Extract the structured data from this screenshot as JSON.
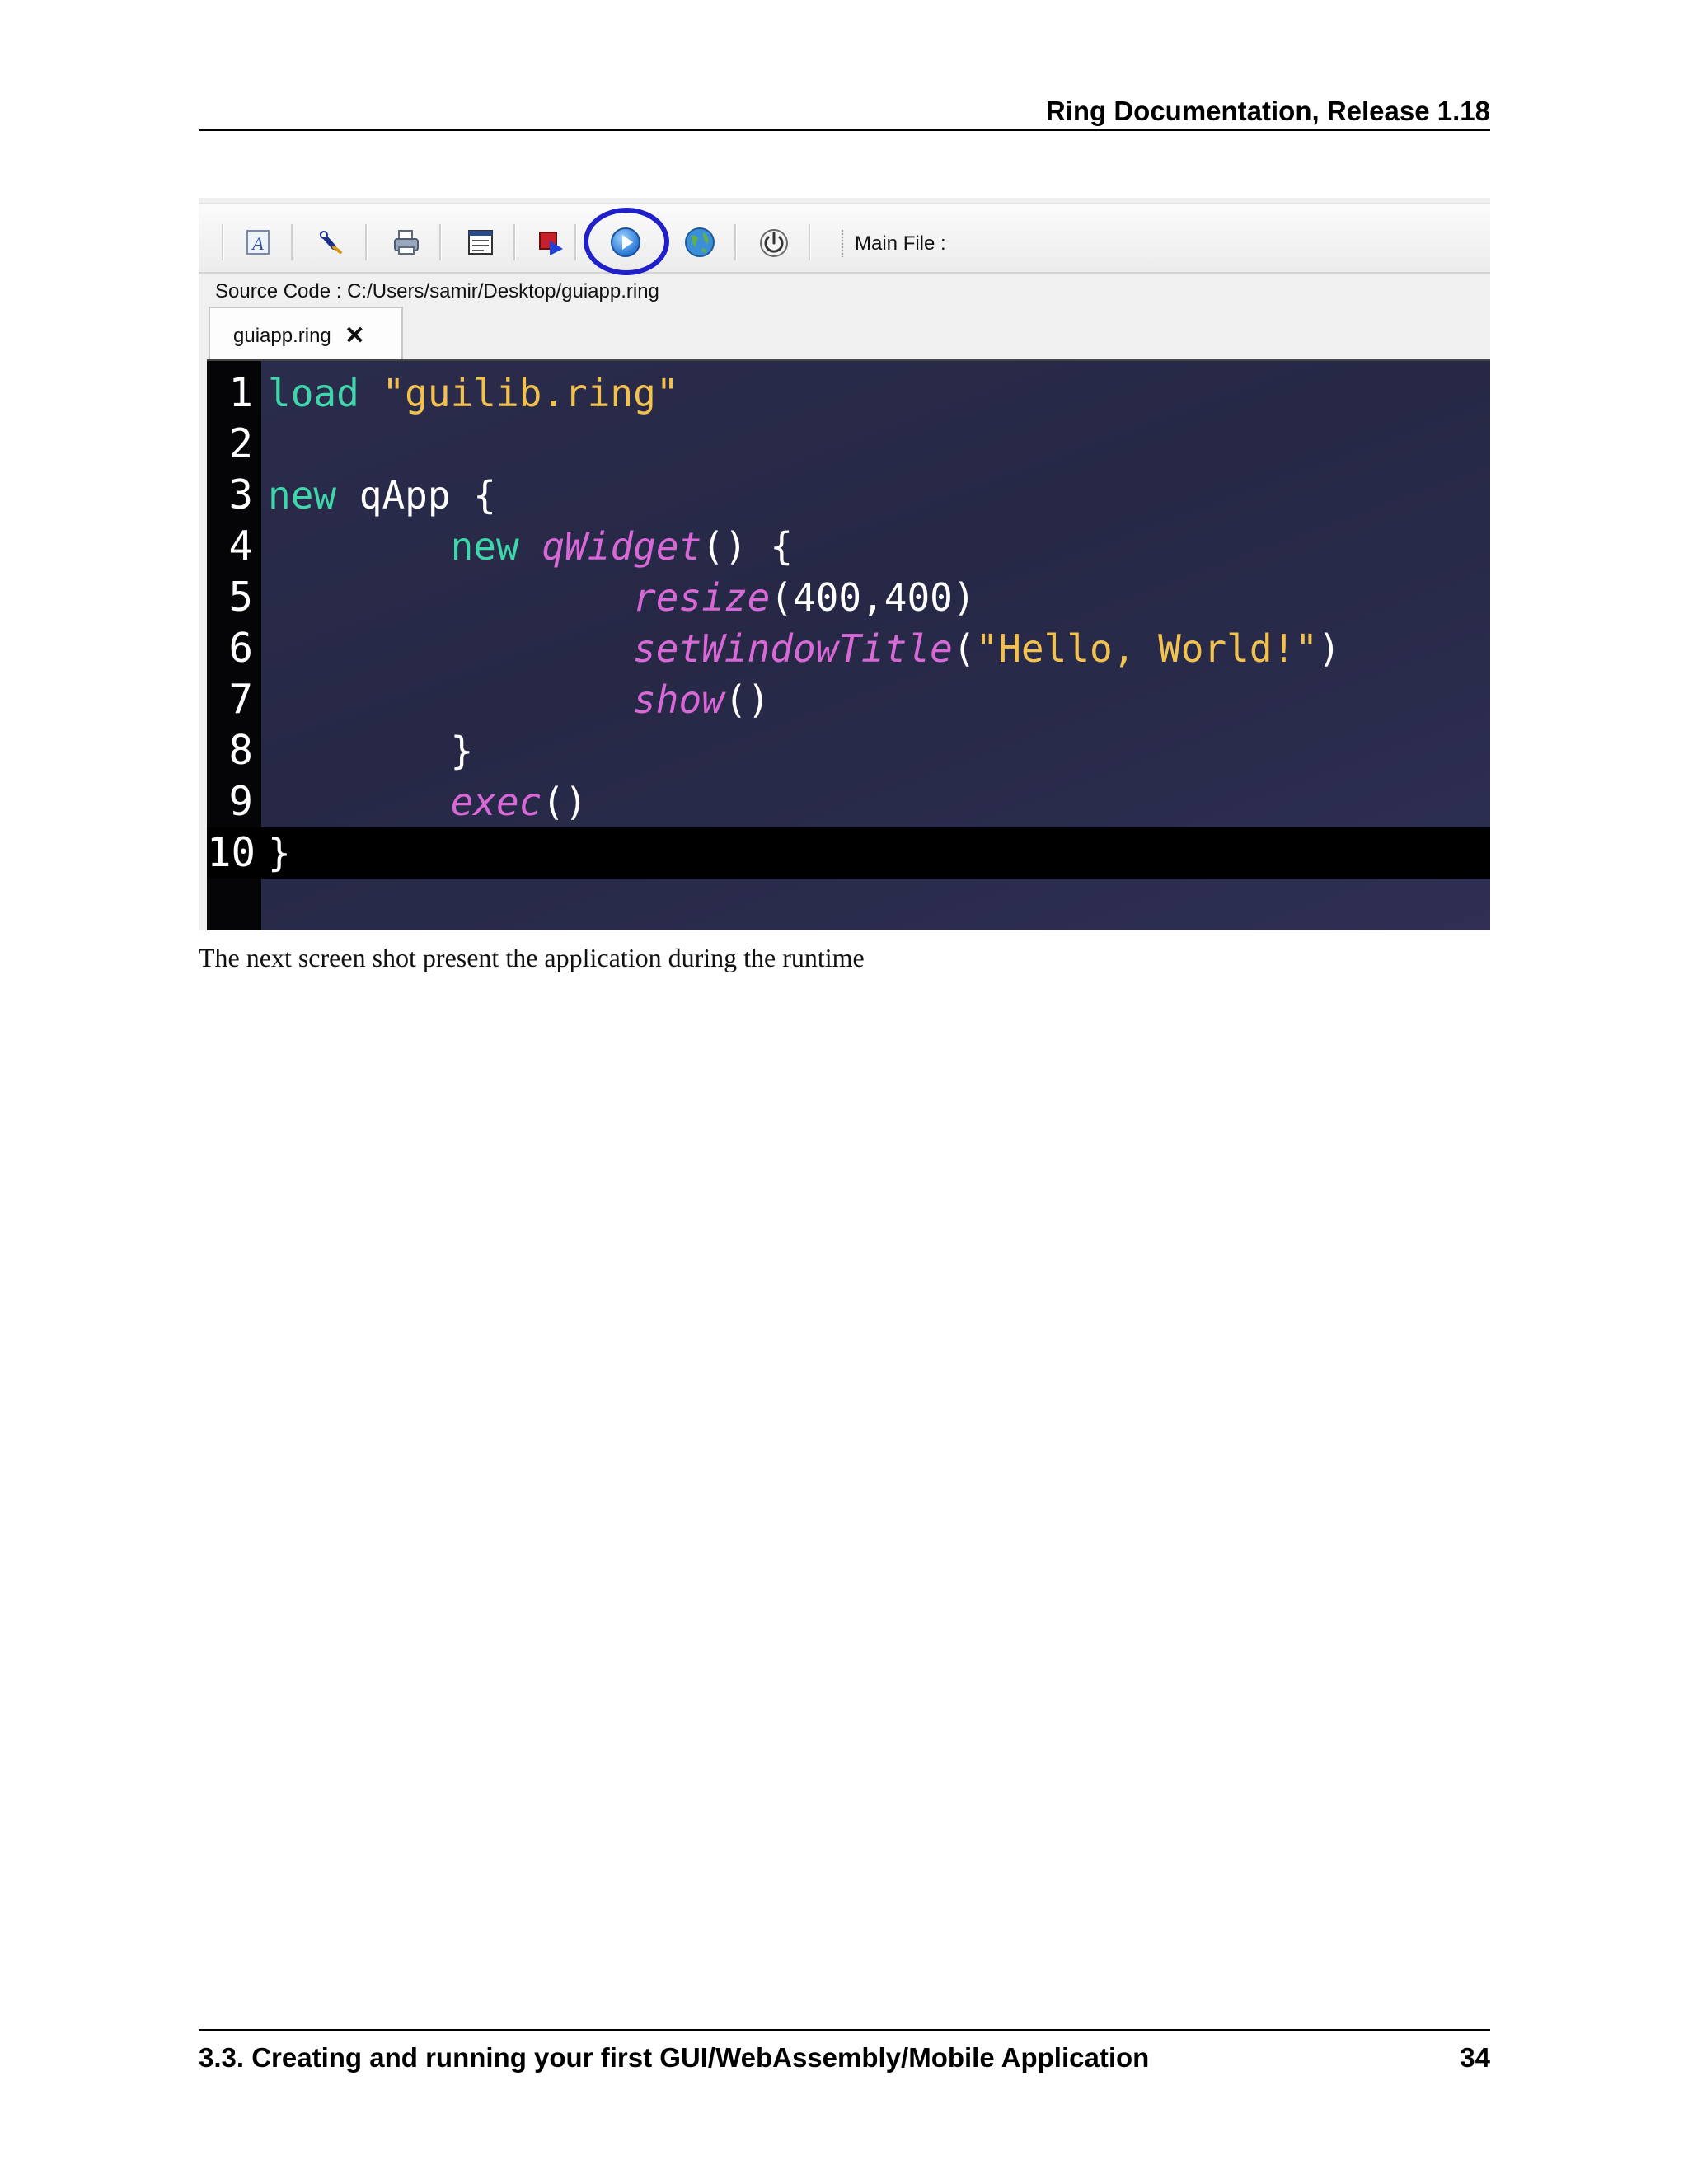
{
  "header": {
    "title": "Ring Documentation, Release 1.18"
  },
  "toolbar": {
    "buttons": [
      {
        "icon": "font-icon"
      },
      {
        "icon": "paint-brush-icon"
      },
      {
        "icon": "print-icon"
      },
      {
        "icon": "form-designer-icon"
      },
      {
        "icon": "debug-icon"
      },
      {
        "icon": "run-icon",
        "highlighted": true
      },
      {
        "icon": "web-globe-icon"
      },
      {
        "icon": "power-icon"
      }
    ],
    "main_file_label": "Main File :",
    "highlight_color": "#2020c8"
  },
  "source": {
    "label": "Source Code :",
    "path": "C:/Users/samir/Desktop/guiapp.ring"
  },
  "tab": {
    "label": "guiapp.ring",
    "close": "✕"
  },
  "editor": {
    "current_line": 10,
    "colors": {
      "keyword": "#3ed6aa",
      "string": "#f2c14e",
      "function": "#d768d6",
      "text": "#ffffff"
    },
    "lines": [
      {
        "n": "1",
        "tokens": [
          [
            "kw",
            "load"
          ],
          [
            "t",
            " "
          ],
          [
            "str",
            "\"guilib.ring\""
          ]
        ]
      },
      {
        "n": "2",
        "tokens": []
      },
      {
        "n": "3",
        "tokens": [
          [
            "kw",
            "new"
          ],
          [
            "t",
            " qApp {"
          ]
        ]
      },
      {
        "n": "4",
        "tokens": [
          [
            "t",
            "        "
          ],
          [
            "kw",
            "new"
          ],
          [
            "t",
            " "
          ],
          [
            "fn",
            "qWidget"
          ],
          [
            "t",
            "() {"
          ]
        ]
      },
      {
        "n": "5",
        "tokens": [
          [
            "t",
            "                "
          ],
          [
            "fn",
            "resize"
          ],
          [
            "t",
            "(400,400)"
          ]
        ]
      },
      {
        "n": "6",
        "tokens": [
          [
            "t",
            "                "
          ],
          [
            "fn",
            "setWindowTitle"
          ],
          [
            "t",
            "("
          ],
          [
            "str",
            "\"Hello, World!\""
          ],
          [
            "t",
            ")"
          ]
        ]
      },
      {
        "n": "7",
        "tokens": [
          [
            "t",
            "                "
          ],
          [
            "fn",
            "show"
          ],
          [
            "t",
            "()"
          ]
        ]
      },
      {
        "n": "8",
        "tokens": [
          [
            "t",
            "        }"
          ]
        ]
      },
      {
        "n": "9",
        "tokens": [
          [
            "t",
            "        "
          ],
          [
            "fn",
            "exec"
          ],
          [
            "t",
            "()"
          ]
        ]
      },
      {
        "n": "10",
        "tokens": [
          [
            "t",
            "}"
          ]
        ]
      }
    ]
  },
  "caption": "The next screen shot present the application during the runtime",
  "footer": {
    "section": "3.3.  Creating and running your first GUI/WebAssembly/Mobile Application",
    "page": "34"
  }
}
